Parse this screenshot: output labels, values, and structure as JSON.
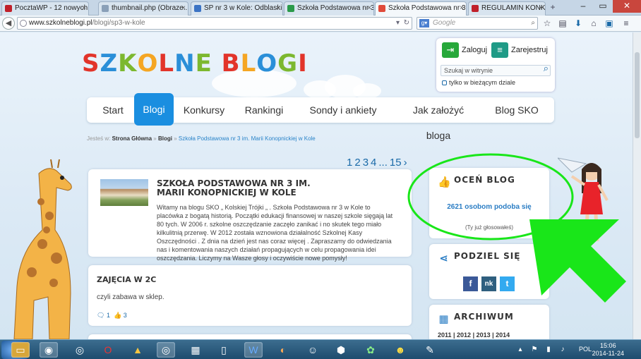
{
  "browser": {
    "tabs": [
      {
        "title": "PocztaWP - 12 nowych",
        "icon": "wp-icon",
        "color": "#c0202a"
      },
      {
        "title": "thumbnail.php (Obraze...",
        "icon": "page-icon",
        "color": "#8aa0b8"
      },
      {
        "title": "SP nr 3 w Kole: Odblaski...",
        "icon": "site-icon",
        "color": "#3b73c4"
      },
      {
        "title": "Szkoła Podstawowa nr 3...",
        "icon": "sheet-icon",
        "color": "#2a9a4a"
      },
      {
        "title": "Szkoła Podstawowa nr 3...",
        "icon": "sb-icon",
        "color": "#e04a3a",
        "active": true
      },
      {
        "title": "REGULAMIN KONKURS...",
        "icon": "wp-icon",
        "color": "#c0202a"
      }
    ],
    "url_domain": "www.szkolneblogi.pl",
    "url_path": "/blogi/sp3-w-kole",
    "search_placeholder": "Google"
  },
  "site": {
    "logo": "SZKOLNE BLOGI",
    "login_label": "Zaloguj",
    "register_label": "Zarejestruj",
    "search_placeholder": "Szukaj w witrynie",
    "only_section_label": "tylko w bieżącym dziale",
    "menu": [
      "Start",
      "Blogi",
      "Konkursy",
      "Rankingi",
      "Sondy i ankiety",
      "Jak założyć bloga",
      "Blog SKO"
    ],
    "menu_active": "Blogi",
    "breadcrumb": {
      "prefix": "Jesteś w:",
      "items": [
        "Strona Główna",
        "Blogi"
      ],
      "current": "Szkoła Podstawowa nr 3 im. Marii Konopnickiej w Kole",
      "sep": "»"
    },
    "pager": [
      "1",
      "2",
      "3",
      "4",
      "...",
      "15",
      "›"
    ]
  },
  "blog": {
    "title": "Szkoła Podstawowa nr 3 im. Marii Konopnickiej w Kole",
    "intro": "Witamy na blogu SKO „ Kolskiej Trójki „ . Szkoła Podstawowa nr 3 w Kole to placówka z bogatą historią. Początki edukacji finansowej w naszej szkole sięgają lat 80 tych. W 2006 r. szkolne oszczędzanie zaczęło zanikać i no skutek tego miało kilkulitnią przerwę. W 2012 została wznowiona działalność Szkolnej Kasy Oszczędności . Z dnia na dzień jest nas coraz więcej . Zapraszamy do odwiedzania nas i komentowania naszych działań propagujących w celu propagowania idei oszczędzania. Liczymy na Wasze głosy i oczywiście nowe pomysły!",
    "post_title": "ZAJĘCIA W 2C",
    "post_text": "czyli zabawa w sklep.",
    "post_comments": "1",
    "post_likes": "3"
  },
  "sidebar": {
    "rate_title": "OCEŃ BLOG",
    "likes": "2621 osobom podoba się",
    "voted": "(Ty już głosowałeś)",
    "share_title": "PODZIEL SIĘ",
    "share_icons": [
      "f",
      "nk",
      "t"
    ],
    "archive_title": "ARCHIWUM",
    "archive_years": "2011 | 2012 | 2013 | 2014"
  },
  "taskbar": {
    "lang": "POL",
    "time": "15:06",
    "date": "2014-11-24"
  },
  "colors": {
    "accent": "#1a8ee0",
    "annotation": "#19e619"
  }
}
